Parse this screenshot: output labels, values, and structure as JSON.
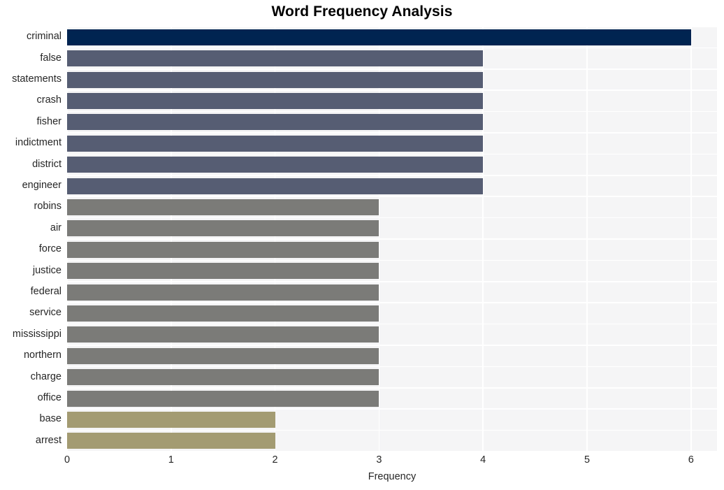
{
  "chart_data": {
    "type": "bar",
    "orientation": "horizontal",
    "title": "Word Frequency Analysis",
    "xlabel": "Frequency",
    "ylabel": "",
    "xlim": [
      0,
      6.25
    ],
    "xticks": [
      0,
      1,
      2,
      3,
      4,
      5,
      6
    ],
    "xticklabels": [
      "0",
      "1",
      "2",
      "3",
      "4",
      "5",
      "6"
    ],
    "grid": true,
    "legend": null,
    "categories": [
      "criminal",
      "false",
      "statements",
      "crash",
      "fisher",
      "indictment",
      "district",
      "engineer",
      "robins",
      "air",
      "force",
      "justice",
      "federal",
      "service",
      "mississippi",
      "northern",
      "charge",
      "office",
      "base",
      "arrest"
    ],
    "values": [
      6,
      4,
      4,
      4,
      4,
      4,
      4,
      4,
      3,
      3,
      3,
      3,
      3,
      3,
      3,
      3,
      3,
      3,
      2,
      2
    ],
    "bar_colors": [
      "#002451",
      "#565d73",
      "#565d73",
      "#565d73",
      "#565d73",
      "#565d73",
      "#565d73",
      "#565d73",
      "#7b7b78",
      "#7b7b78",
      "#7b7b78",
      "#7b7b78",
      "#7b7b78",
      "#7b7b78",
      "#7b7b78",
      "#7b7b78",
      "#7b7b78",
      "#7b7b78",
      "#a39b72",
      "#a39b72"
    ],
    "plot_background": "#f5f5f6",
    "gridline_color": "#ffffff",
    "figure_background": "#ffffff"
  }
}
